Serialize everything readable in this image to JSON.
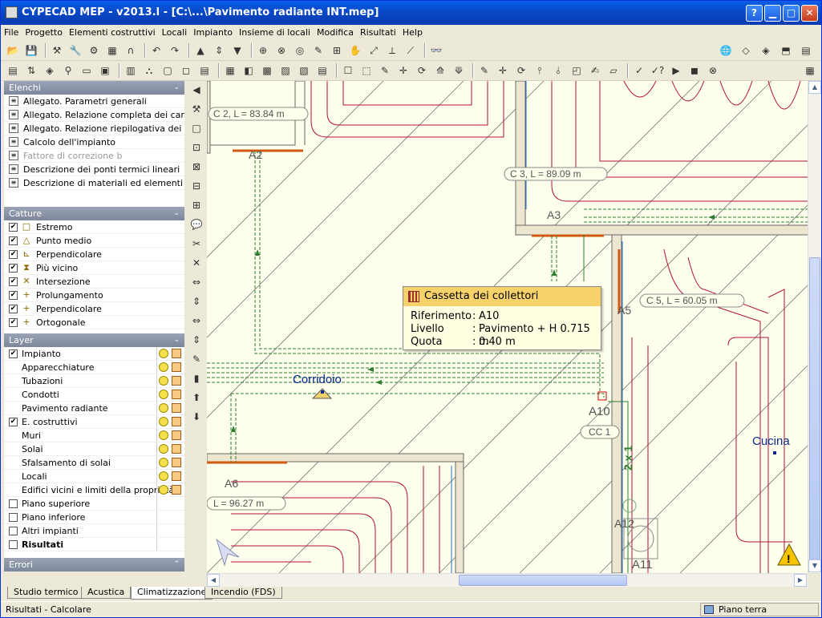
{
  "window": {
    "title": "CYPECAD MEP - v2013.l - [C:\\...\\Pavimento radiante INT.mep]",
    "min_icon": "minimize-icon",
    "max_icon": "maximize-icon",
    "close_icon": "close-icon"
  },
  "menu": [
    "File",
    "Progetto",
    "Elementi costruttivi",
    "Locali",
    "Impianto",
    "Insieme di locali",
    "Modifica",
    "Risultati",
    "Help"
  ],
  "panels": {
    "elenchi": {
      "title": "Elenchi",
      "items": [
        {
          "label": "Allegato. Parametri generali",
          "enabled": true
        },
        {
          "label": "Allegato. Relazione completa dei carich...",
          "enabled": true
        },
        {
          "label": "Allegato. Relazione riepilogativa dei car...",
          "enabled": true
        },
        {
          "label": "Calcolo dell'impianto",
          "enabled": true
        },
        {
          "label": "Fattore di correzione b",
          "enabled": false
        },
        {
          "label": "Descrizione dei ponti termici lineari",
          "enabled": true
        },
        {
          "label": "Descrizione di materiali ed elementi cos...",
          "enabled": true
        }
      ]
    },
    "catture": {
      "title": "Catture",
      "items": [
        {
          "label": "Estremo",
          "icon": "square-snap-icon",
          "checked": true
        },
        {
          "label": "Punto medio",
          "icon": "triangle-snap-icon",
          "checked": true
        },
        {
          "label": "Perpendicolare",
          "icon": "perpendicular-snap-icon",
          "checked": true
        },
        {
          "label": "Più vicino",
          "icon": "hourglass-snap-icon",
          "checked": true
        },
        {
          "label": "Intersezione",
          "icon": "x-snap-icon",
          "checked": true
        },
        {
          "label": "Prolungamento",
          "icon": "plus-snap-icon",
          "checked": true
        },
        {
          "label": "Perpendicolare",
          "icon": "plus-snap-icon",
          "checked": true
        },
        {
          "label": "Ortogonale",
          "icon": "plus-snap-icon",
          "checked": true
        }
      ]
    },
    "layer": {
      "title": "Layer",
      "items": [
        {
          "label": "Impianto",
          "checked": true,
          "indent": false,
          "icons": true
        },
        {
          "label": "Apparecchiature",
          "checked": null,
          "indent": true,
          "icons": true
        },
        {
          "label": "Tubazioni",
          "checked": null,
          "indent": true,
          "icons": true
        },
        {
          "label": "Condotti",
          "checked": null,
          "indent": true,
          "icons": true
        },
        {
          "label": "Pavimento radiante",
          "checked": null,
          "indent": true,
          "icons": true
        },
        {
          "label": "E. costruttivi",
          "checked": true,
          "indent": false,
          "icons": true
        },
        {
          "label": "Muri",
          "checked": null,
          "indent": true,
          "icons": true
        },
        {
          "label": "Solai",
          "checked": null,
          "indent": true,
          "icons": true
        },
        {
          "label": "Sfalsamento di solai",
          "checked": null,
          "indent": true,
          "icons": true
        },
        {
          "label": "Locali",
          "checked": null,
          "indent": true,
          "icons": true
        },
        {
          "label": "Edifici vicini e limiti della proprietà",
          "checked": null,
          "indent": true,
          "icons": true
        },
        {
          "label": "Piano superiore",
          "checked": false,
          "indent": false,
          "icons": false
        },
        {
          "label": "Piano inferiore",
          "checked": false,
          "indent": false,
          "icons": false
        },
        {
          "label": "Altri impianti",
          "checked": false,
          "indent": false,
          "icons": false
        },
        {
          "label": "Risultati",
          "checked": false,
          "indent": false,
          "icons": false,
          "bold": true
        }
      ]
    },
    "errori": {
      "title": "Errori"
    }
  },
  "tooltip": {
    "title": "Cassetta dei collettori",
    "rows": [
      {
        "key": "Riferimento",
        "value": "A10"
      },
      {
        "key": "Livello",
        "value": "Pavimento + H 0.715 m"
      },
      {
        "key": "Quota",
        "value": "0.40 m"
      }
    ]
  },
  "drawing": {
    "labels": {
      "c2": "C 2, L = 83.84 m",
      "c3": "C 3, L = 89.09 m",
      "c5": "C 5, L = 60.05 m",
      "l6": "L = 96.27 m",
      "cc1": "CC 1",
      "a2": "A2",
      "a3": "A3",
      "a5": "A5",
      "a6": "A6",
      "a10": "A10",
      "a11": "A11",
      "a12": "A12",
      "corridoio": "Corridoio",
      "cucina": "Cucina",
      "dim": "2 x 1"
    },
    "colors": {
      "pipe": "#B0103A",
      "wall": "#808080",
      "collector": "#3A8F3A",
      "text_room": "#0B2A8F",
      "bg": "#FFFFEE"
    }
  },
  "tabs": [
    {
      "label": "Studio termico",
      "active": false
    },
    {
      "label": "Acustica",
      "active": false
    },
    {
      "label": "Climatizzazione",
      "active": true
    },
    {
      "label": "Incendio (FDS)",
      "active": false
    }
  ],
  "status": {
    "left": "Risultati - Calcolare",
    "right": "Piano terra"
  }
}
